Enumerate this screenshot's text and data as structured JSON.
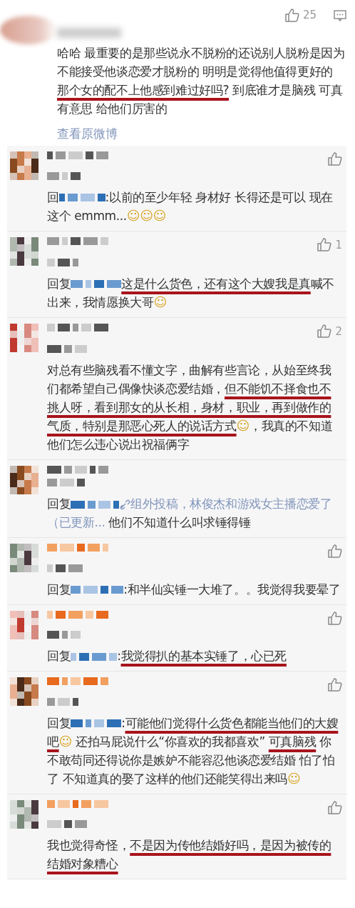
{
  "top_comment": {
    "likes": "25",
    "segments": [
      {
        "kind": "text",
        "text": "哈哈 最重要的是那些说永不脱粉的还说别人脱粉是因为不能接受他谈恋爱才脱粉的 明明是觉得他值得更好的 "
      },
      {
        "kind": "underlined",
        "text": "那个女的配不上他感到难过好吗?"
      },
      {
        "kind": "text",
        "text": " 到底谁才是脑残 可真有意思 给他们厉害的"
      }
    ],
    "view_original": "查看原微博"
  },
  "replies": [
    {
      "like_button": true,
      "prefix": "回",
      "segments": [
        {
          "kind": "text",
          "text": ":以前的至少年轻 身材好 长得还是可以 现在这个 emmm..."
        },
        {
          "kind": "emoji",
          "text": "☺"
        },
        {
          "kind": "emoji",
          "text": "☺"
        },
        {
          "kind": "emoji",
          "text": "☺"
        }
      ]
    },
    {
      "like_button": true,
      "likes": "1",
      "prefix": "回复",
      "segments": [
        {
          "kind": "underlined",
          "text": "这是什么货色，还有这个大嫂我是真"
        },
        {
          "kind": "text",
          "text": "喊不出来，我情愿换大哥"
        },
        {
          "kind": "emoji",
          "text": "☺"
        }
      ]
    },
    {
      "like_button": true,
      "likes": "2",
      "segments": [
        {
          "kind": "text",
          "text": "对总有些脑残看不懂文字，曲解有些言论，从始至终我们都希望自己偶像快谈恋爱结婚，"
        },
        {
          "kind": "underlined",
          "text": "但不能饥不择食也不挑人呀，看到那女的从长相，身材，职业，再到做作的气质，特别是那恶心死人的说话方式"
        },
        {
          "kind": "emoji",
          "text": "☺"
        },
        {
          "kind": "text",
          "text": "，我真的不知道他们怎么违心说出祝福俩字"
        }
      ]
    },
    {
      "like_button": false,
      "prefix": "回复",
      "segments": [
        {
          "kind": "link",
          "text": "组外投稿，林俊杰和游戏女主播恋爱了"
        },
        {
          "kind": "link",
          "text": "（已更新..."
        },
        {
          "kind": "text",
          "text": " 他们不知道什么叫求锤得锤"
        }
      ]
    },
    {
      "like_button": true,
      "prefix": "回复",
      "segments": [
        {
          "kind": "text",
          "text": ":和半仙实锤一大堆了。。我觉得我要晕了"
        }
      ]
    },
    {
      "like_button": true,
      "prefix": "回复",
      "segments": [
        {
          "kind": "text",
          "text": ":"
        },
        {
          "kind": "underlined",
          "text": "我觉得扒的基本实锤了，心已死"
        }
      ]
    },
    {
      "like_button": true,
      "prefix": "回复",
      "segments": [
        {
          "kind": "text",
          "text": ":"
        },
        {
          "kind": "underlined",
          "text": "可能他们觉得什么货色都能当他们的大嫂吧"
        },
        {
          "kind": "emoji",
          "text": "☺"
        },
        {
          "kind": "text",
          "text": " 还拍马屁说什么“你喜欢的我都喜欢” "
        },
        {
          "kind": "underlined",
          "text": "可真脑残"
        },
        {
          "kind": "text",
          "text": " 你不敢苟同还得说你是嫉妒不能容忍他谈恋爱结婚 怕了怕了 不知道真的娶了这样的他们还能笑得出来吗"
        },
        {
          "kind": "emoji",
          "text": "☺"
        }
      ]
    },
    {
      "like_button": true,
      "segments": [
        {
          "kind": "text",
          "text": "我也觉得奇怪，"
        },
        {
          "kind": "underlined",
          "text": "不是因为传他结婚好吗，是因为被传的结婚对象糟心"
        }
      ]
    }
  ]
}
